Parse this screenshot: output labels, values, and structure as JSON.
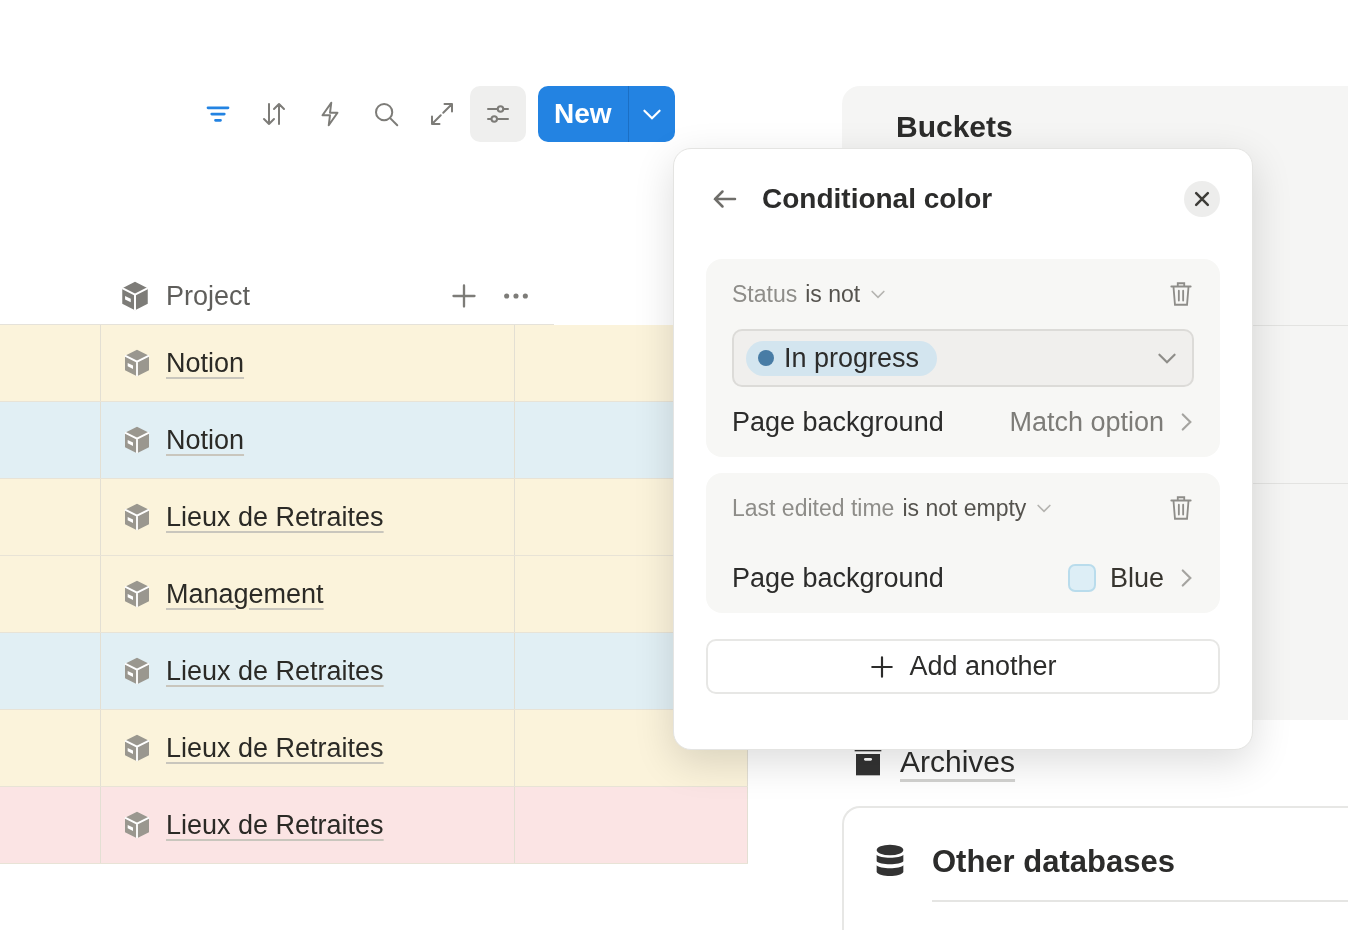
{
  "toolbar": {
    "icons": [
      {
        "kind": "filter",
        "active": true,
        "pressed": false
      },
      {
        "kind": "sort",
        "active": false,
        "pressed": false
      },
      {
        "kind": "automation",
        "active": false,
        "pressed": false
      },
      {
        "kind": "search",
        "active": false,
        "pressed": false
      },
      {
        "kind": "expand",
        "active": false,
        "pressed": false
      },
      {
        "kind": "settings",
        "active": false,
        "pressed": true
      }
    ],
    "new_button": {
      "label": "New"
    }
  },
  "table": {
    "column_header": "Project",
    "rows": [
      {
        "title": "Notion",
        "color": "#fbf3db"
      },
      {
        "title": "Notion",
        "color": "#e1eff4"
      },
      {
        "title": "Lieux de Retraites",
        "color": "#fbf3db"
      },
      {
        "title": "Management",
        "color": "#fbf3db"
      },
      {
        "title": "Lieux de Retraites",
        "color": "#e1eff4"
      },
      {
        "title": "Lieux de Retraites",
        "color": "#fbf3db"
      },
      {
        "title": "Lieux de Retraites",
        "color": "#fbe4e4"
      }
    ]
  },
  "side": {
    "buckets_title": "Buckets",
    "archives": "Archives",
    "other_title": "Other databases"
  },
  "popup": {
    "title": "Conditional color",
    "rules": [
      {
        "kind": "select",
        "property": "Status",
        "operator": "is not",
        "value_tag": {
          "label": "In progress",
          "color": "#487ca5"
        },
        "target": "Page background",
        "color_label": "Match option"
      },
      {
        "kind": "plain",
        "property": "Last edited time",
        "operator": "is not empty",
        "target": "Page background",
        "color_label": "Blue"
      }
    ],
    "add_label": "Add another"
  }
}
